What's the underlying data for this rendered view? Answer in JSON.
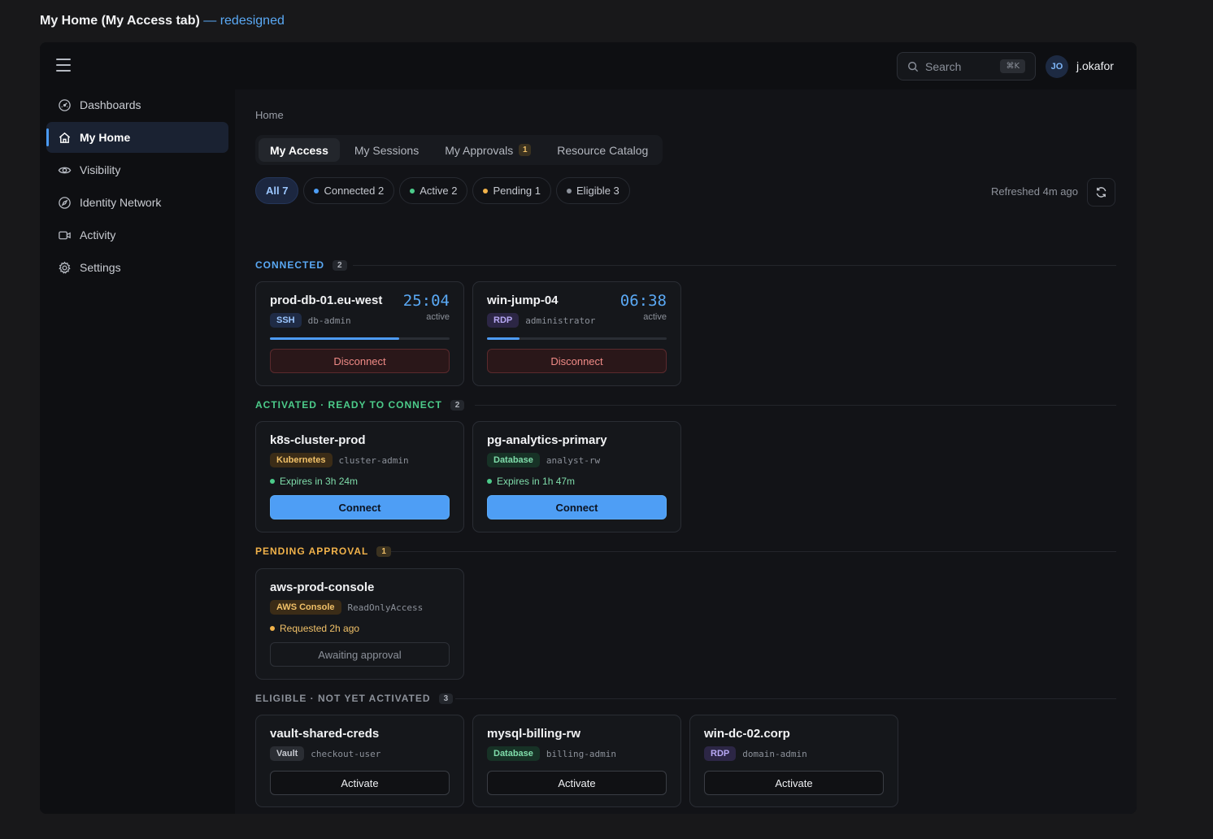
{
  "heading": {
    "main": "My Home (My Access tab)",
    "suffix": "— redesigned"
  },
  "topbar": {
    "menu_icon": "menu-icon",
    "search": {
      "placeholder": "Search",
      "shortcut": "⌘K",
      "icon": "search-icon"
    },
    "user": {
      "initials": "JO",
      "name": "j.okafor"
    }
  },
  "sidebar": {
    "items": [
      {
        "label": "Dashboards",
        "icon": "dashboard-gauge-icon"
      },
      {
        "label": "My Home",
        "icon": "home-icon",
        "active": true
      },
      {
        "label": "Visibility",
        "icon": "eye-icon"
      },
      {
        "label": "Identity Network",
        "icon": "compass-icon"
      },
      {
        "label": "Activity",
        "icon": "activity-video-icon"
      },
      {
        "label": "Settings",
        "icon": "gear-icon"
      }
    ]
  },
  "breadcrumb": "Home",
  "tabs": [
    {
      "label": "My Access",
      "active": true
    },
    {
      "label": "My Sessions"
    },
    {
      "label": "My Approvals",
      "badge": "1"
    },
    {
      "label": "Resource Catalog"
    }
  ],
  "filters": [
    {
      "label": "All 7",
      "active": true
    },
    {
      "label": "Connected 2",
      "dot": "#4e9ef5"
    },
    {
      "label": "Active 2",
      "dot": "#4ccb8a"
    },
    {
      "label": "Pending 1",
      "dot": "#f1b24a"
    },
    {
      "label": "Eligible 3",
      "dot": "#8c919a"
    }
  ],
  "refreshed": "Refreshed 4m ago",
  "colors": {
    "connected": "#5aa9f5",
    "activated": "#4ccb8a",
    "pending": "#f1b24a",
    "eligible": "#8c919a"
  },
  "sections": {
    "connected": {
      "title": "CONNECTED",
      "count": "2",
      "cards": [
        {
          "name": "prod-db-01.eu-west",
          "tag": "SSH",
          "role": "db-admin",
          "timer": "25:04",
          "timer_sub": "active",
          "progress": 0.72,
          "button": "Disconnect"
        },
        {
          "name": "win-jump-04",
          "tag": "RDP",
          "role": "administrator",
          "timer": "06:38",
          "timer_sub": "active",
          "progress": 0.18,
          "button": "Disconnect"
        }
      ]
    },
    "activated": {
      "title": "ACTIVATED · READY TO CONNECT",
      "count": "2",
      "cards": [
        {
          "name": "k8s-cluster-prod",
          "tag": "Kubernetes",
          "role": "cluster-admin",
          "status": "Expires in 3h 24m",
          "button": "Connect"
        },
        {
          "name": "pg-analytics-primary",
          "tag": "Database",
          "role": "analyst-rw",
          "status": "Expires in 1h 47m",
          "button": "Connect"
        }
      ]
    },
    "pending": {
      "title": "PENDING APPROVAL",
      "count": "1",
      "cards": [
        {
          "name": "aws-prod-console",
          "tag": "AWS Console",
          "role": "ReadOnlyAccess",
          "status": "Requested 2h ago",
          "button": "Awaiting approval"
        }
      ]
    },
    "eligible": {
      "title": "ELIGIBLE · NOT YET ACTIVATED",
      "count": "3",
      "cards": [
        {
          "name": "vault-shared-creds",
          "tag": "Vault",
          "role": "checkout-user",
          "button": "Activate"
        },
        {
          "name": "mysql-billing-rw",
          "tag": "Database",
          "role": "billing-admin",
          "button": "Activate"
        },
        {
          "name": "win-dc-02.corp",
          "tag": "RDP",
          "role": "domain-admin",
          "button": "Activate"
        }
      ]
    }
  }
}
